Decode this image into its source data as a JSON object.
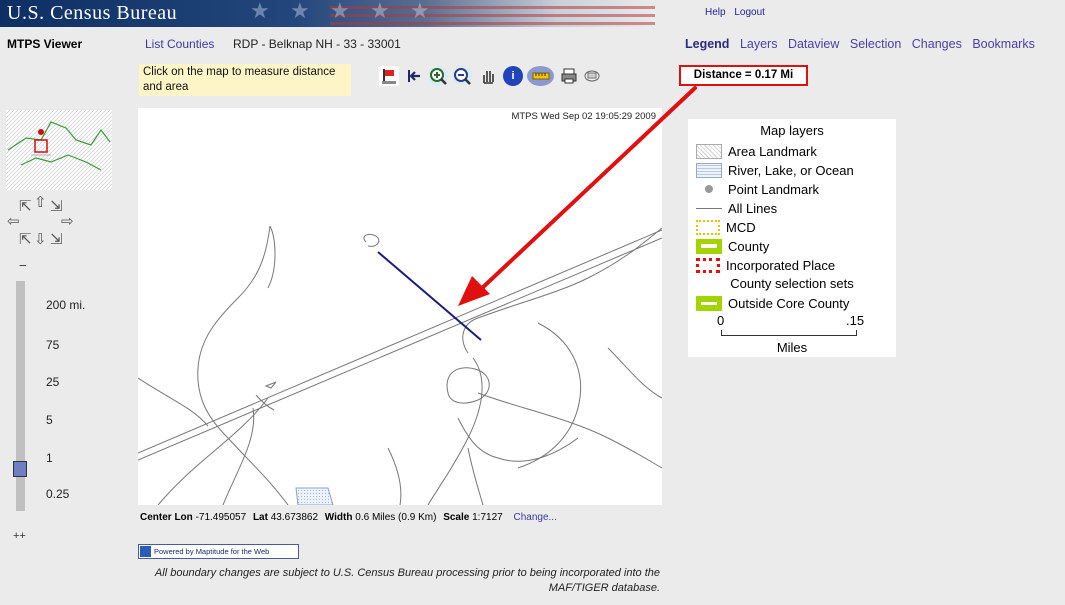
{
  "banner": {
    "title": "U.S. Census Bureau"
  },
  "top_links": {
    "help": "Help",
    "logout": "Logout"
  },
  "header": {
    "app_title": "MTPS Viewer",
    "list_counties": "List Counties",
    "county_info": "RDP - Belknap NH - 33 - 33001"
  },
  "nav_tabs": [
    "Legend",
    "Layers",
    "Dataview",
    "Selection",
    "Changes",
    "Bookmarks"
  ],
  "toolbar": {
    "tip": "Click on the map to measure distance and area",
    "tools": [
      "measure-flag-icon",
      "back-arrow-icon",
      "zoom-in-icon",
      "zoom-out-icon",
      "pan-hand-icon",
      "info-icon",
      "ruler-icon",
      "print-icon",
      "clear-icon"
    ],
    "distance": "Distance = 0.17 Mi"
  },
  "zoom": {
    "minus": "−",
    "levels": [
      "200 mi.",
      "75",
      "25",
      "5",
      "1",
      "0.25"
    ],
    "plus": "++",
    "current_level": "1"
  },
  "map": {
    "timestamp": "MTPS Wed Sep 02 19:05:29 2009"
  },
  "legend": {
    "title": "Map layers",
    "items": [
      "Area Landmark",
      "River, Lake, or Ocean",
      "Point Landmark",
      "All Lines",
      "MCD",
      "County",
      "Incorporated Place"
    ],
    "sets_title": "County selection sets",
    "sets": [
      "Outside Core County"
    ],
    "scale": {
      "zero": "0",
      "max": ".15",
      "units": "Miles"
    }
  },
  "status": {
    "center_lon_label": "Center Lon",
    "center_lon": "-71.495057",
    "lat_label": "Lat",
    "lat": "43.673862",
    "width_label": "Width",
    "width": "0.6 Miles (0.9 Km)",
    "scale_label": "Scale",
    "scale": "1:7127",
    "change": "Change..."
  },
  "powered_by": "Powered by Maptitude for the Web",
  "footer": "All boundary changes are subject to U.S. Census Bureau processing prior to being incorporated into the MAF/TIGER database.",
  "colors": {
    "accent_red": "#e01010",
    "link": "#4a3fa8",
    "banner": "#0d2f63"
  }
}
